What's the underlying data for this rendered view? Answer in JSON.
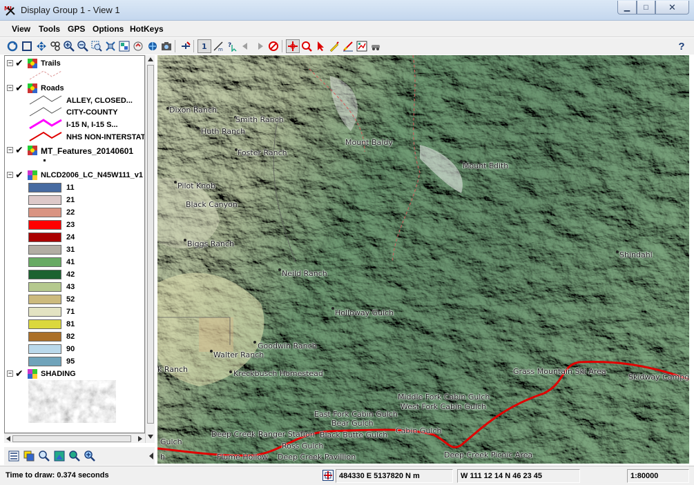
{
  "window": {
    "title": "Display Group 1 - View 1",
    "minimize": "▁",
    "maximize": "□",
    "close": "✕"
  },
  "menu": [
    "View",
    "Tools",
    "GPS",
    "Options",
    "HotKeys"
  ],
  "toolbar": {
    "help_label": "?",
    "icons": [
      "redraw-icon",
      "full-extent-icon",
      "pan-icon",
      "zoom-extent-icon",
      "zoom-in-icon",
      "zoom-out-icon",
      "zoom-box-icon",
      "zoom-layer-icon",
      "zoom-previous-icon",
      "refresh-icon",
      "render-icon",
      "snapshot-icon",
      "add-layer-icon",
      "select-icon",
      "measure-icon",
      "info-icon",
      "back-icon",
      "forward-icon",
      "stop-icon",
      "cursor-cross-icon",
      "zoom-cursor-icon",
      "pointer-icon",
      "draw-icon",
      "edit-icon",
      "chart-icon",
      "vehicle-icon",
      "help-icon"
    ]
  },
  "legend": {
    "layers": [
      {
        "name": "Trails",
        "expanded": true,
        "checked": true
      },
      {
        "name": "Roads",
        "expanded": true,
        "checked": true,
        "symbols": [
          {
            "label": "ALLEY, CLOSED...",
            "color": "#505050"
          },
          {
            "label": "CITY-COUNTY",
            "color": "#505050"
          },
          {
            "label": "I-15 N, I-15 S...",
            "color": "#ff00ff"
          },
          {
            "label": "NHS NON-INTERSTATE",
            "color": "#e00000"
          }
        ]
      },
      {
        "name": "MT_Features_20140601",
        "expanded": true,
        "checked": true
      },
      {
        "name": "NLCD2006_LC_N45W111_v1",
        "expanded": true,
        "checked": true,
        "classes": [
          {
            "label": "11",
            "color": "#476ba1"
          },
          {
            "label": "21",
            "color": "#ddc9c9"
          },
          {
            "label": "22",
            "color": "#d99482"
          },
          {
            "label": "23",
            "color": "#ff0000"
          },
          {
            "label": "24",
            "color": "#aa0000"
          },
          {
            "label": "31",
            "color": "#b2ada3"
          },
          {
            "label": "41",
            "color": "#68aa63"
          },
          {
            "label": "42",
            "color": "#1c6330"
          },
          {
            "label": "43",
            "color": "#b5c98e"
          },
          {
            "label": "52",
            "color": "#ccba7d"
          },
          {
            "label": "71",
            "color": "#e3e3c2"
          },
          {
            "label": "81",
            "color": "#dbd83d"
          },
          {
            "label": "82",
            "color": "#ab7028"
          },
          {
            "label": "90",
            "color": "#bad9eb"
          },
          {
            "label": "95",
            "color": "#70a3ba"
          }
        ]
      },
      {
        "name": "SHADING",
        "expanded": true,
        "checked": true
      }
    ]
  },
  "map": {
    "labels": [
      "Dixon Ranch",
      "Smith Ranch",
      "Huth Ranch",
      "Foster Ranch",
      "Mount Baldy",
      "Mount Edith",
      "Pilot Knob",
      "Black Canyon",
      "Biggs Ranch",
      "Neild Ranch",
      "Shindahl",
      "Holloway Gulch",
      "Goodwin Ranch",
      "Walter Ranch",
      "k Ranch",
      "Kreckbusch Homestead",
      "Grass Mountain Ski Area",
      "Skidway Campg",
      "Middle Fork Cabin Gulch",
      "West Fork Cabin Gulch",
      "East Fork Cabin Gulch",
      "Bear Gulch",
      "Deep Creek Ranger Station",
      "Black Butte Gulch",
      "Cabin Gulch",
      "Gulch",
      "Ross Gulch",
      "Flume Hollow",
      "Deep Creek Pavillion",
      "Deep Creek Picnic Area",
      "h"
    ]
  },
  "status": {
    "draw_time": "Time to draw: 0.374 seconds",
    "projected_coords": "484330 E  5137820 N m",
    "geo_coords": "W 111 12 14  N 46 23 45",
    "scale": "1:80000"
  }
}
